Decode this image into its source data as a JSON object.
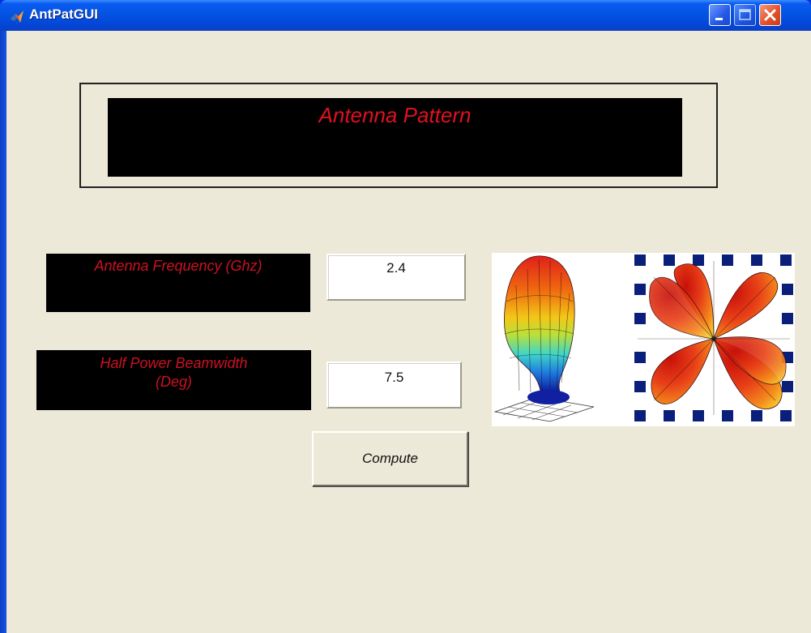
{
  "window": {
    "title": "AntPatGUI"
  },
  "header": {
    "title": "Antenna Pattern"
  },
  "form": {
    "frequency_label": "Antenna Frequency (Ghz)",
    "frequency_value": "2.4",
    "beamwidth_label_line1": "Half Power Beamwidth",
    "beamwidth_label_line2": "(Deg)",
    "beamwidth_value": "7.5",
    "compute_label": "Compute"
  },
  "colors": {
    "label_text": "#cc1122",
    "panel_bg": "#000000",
    "client_bg": "#ece9d8",
    "titlebar": "#0454e3"
  },
  "icons": [
    "matlab-logo-icon",
    "minimize-icon",
    "maximize-icon",
    "close-icon"
  ]
}
